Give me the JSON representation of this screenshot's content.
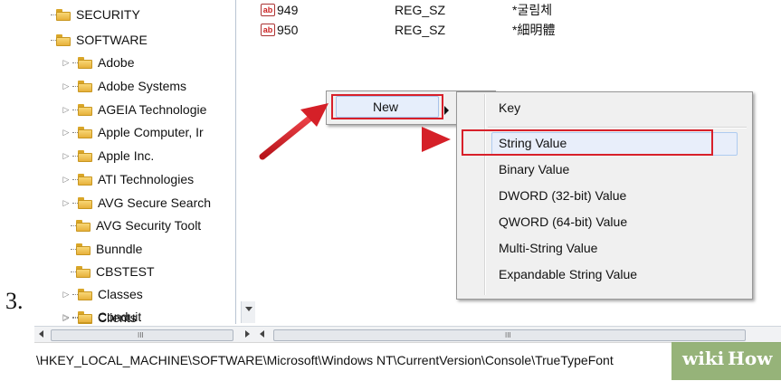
{
  "step_number": "3.",
  "tree": {
    "items": [
      {
        "label": "SECURITY",
        "expander": "",
        "level": 0
      },
      {
        "label": "SOFTWARE",
        "expander": "",
        "level": 0
      },
      {
        "label": "Adobe",
        "expander": "▷",
        "level": 1
      },
      {
        "label": "Adobe Systems",
        "expander": "▷",
        "level": 1
      },
      {
        "label": "AGEIA Technologie",
        "expander": "▷",
        "level": 1
      },
      {
        "label": "Apple Computer, Ir",
        "expander": "▷",
        "level": 1
      },
      {
        "label": "Apple Inc.",
        "expander": "▷",
        "level": 1
      },
      {
        "label": "ATI Technologies",
        "expander": "▷",
        "level": 1
      },
      {
        "label": "AVG Secure Search",
        "expander": "▷",
        "level": 1
      },
      {
        "label": "AVG Security Toolt",
        "expander": "",
        "level": 1
      },
      {
        "label": "Bunndle",
        "expander": "",
        "level": 1
      },
      {
        "label": "CBSTEST",
        "expander": "",
        "level": 1
      },
      {
        "label": "Classes",
        "expander": "▷",
        "level": 1
      },
      {
        "label": "Clients",
        "expander": "▷",
        "level": 1
      },
      {
        "label": "Conduit",
        "expander": "▷",
        "level": 1
      }
    ],
    "hscroll_left_glyph": "III",
    "hscroll_right_glyph": "▸"
  },
  "values": {
    "rows": [
      {
        "icon": "ab",
        "name": "949",
        "type": "REG_SZ",
        "data": "*굴림체"
      },
      {
        "icon": "ab",
        "name": "950",
        "type": "REG_SZ",
        "data": "*細明體"
      }
    ],
    "hscroll_grip": "III"
  },
  "context_menu": {
    "new_label": "New"
  },
  "submenu": {
    "items": [
      "Key",
      "String Value",
      "Binary Value",
      "DWORD (32-bit) Value",
      "QWORD (64-bit) Value",
      "Multi-String Value",
      "Expandable String Value"
    ],
    "highlighted": "String Value"
  },
  "status_bar": {
    "path": "\\HKEY_LOCAL_MACHINE\\SOFTWARE\\Microsoft\\Windows NT\\CurrentVersion\\Console\\TrueTypeFont"
  },
  "watermark": {
    "part1": "wiki",
    "part2": "How"
  },
  "colors": {
    "highlight_red": "#d8202a",
    "selection_blue": "#e6eefb",
    "watermark_green": "#84a662"
  }
}
